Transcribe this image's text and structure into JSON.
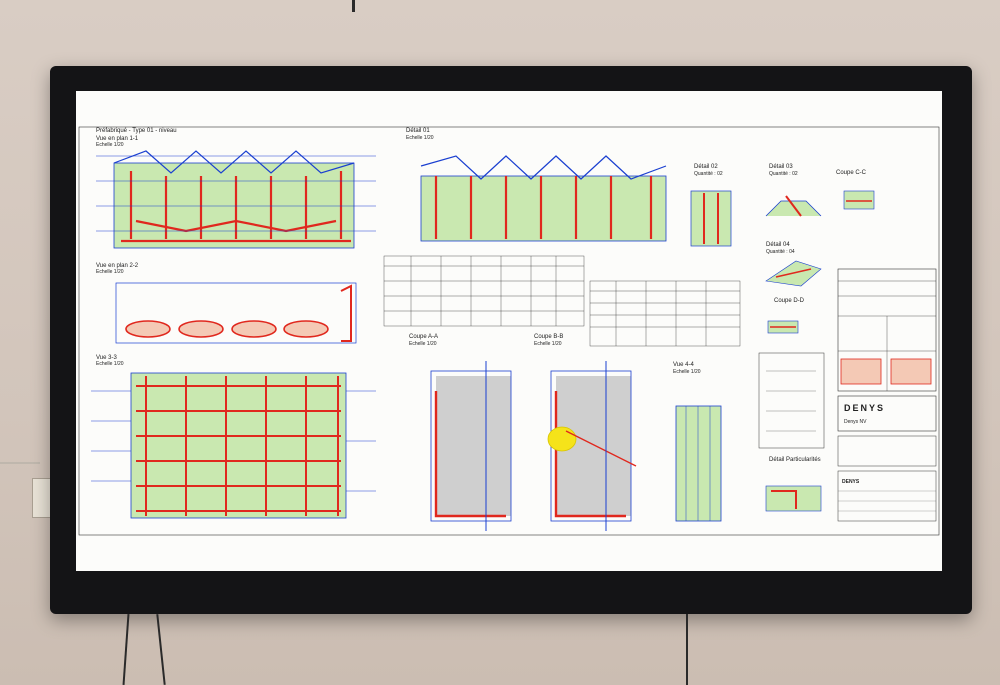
{
  "drawing": {
    "sheet_title": "Préfabriqué - Type 01 - niveau",
    "views": {
      "plan_1_1": "Vue en plan 1-1",
      "plan_2_2": "Vue en plan 2-2",
      "vue_3_3": "Vue 3-3",
      "detail_01": "Détail 01",
      "detail_02": "Détail 02",
      "quantite_02": "Quantité : 02",
      "detail_03": "Détail 03",
      "quantite_03": "Quantité : 02",
      "coupe_cc": "Coupe C-C",
      "detail_04": "Détail 04",
      "quantite_04": "Quantité : 04",
      "coupe_dd": "Coupe D-D",
      "coupe_aa": "Coupe A-A",
      "coupe_bb": "Coupe B-B",
      "vue_4_4": "Vue 4-4",
      "detail_particularites": "Détail Particularités"
    },
    "scale_label": "Echelle 1/20",
    "title_block": {
      "brand": "DENYS",
      "company": "Denys NV",
      "logo_text": "DENYS"
    }
  },
  "colors": {
    "frame": "#141416",
    "screen": "#fcfcfa",
    "rebar_red": "#e0281e",
    "line_blue": "#1a3fd0",
    "fill_green": "#c9e8b0",
    "fill_grey": "#cfcfcf",
    "highlight_yellow": "#f5e31a"
  }
}
